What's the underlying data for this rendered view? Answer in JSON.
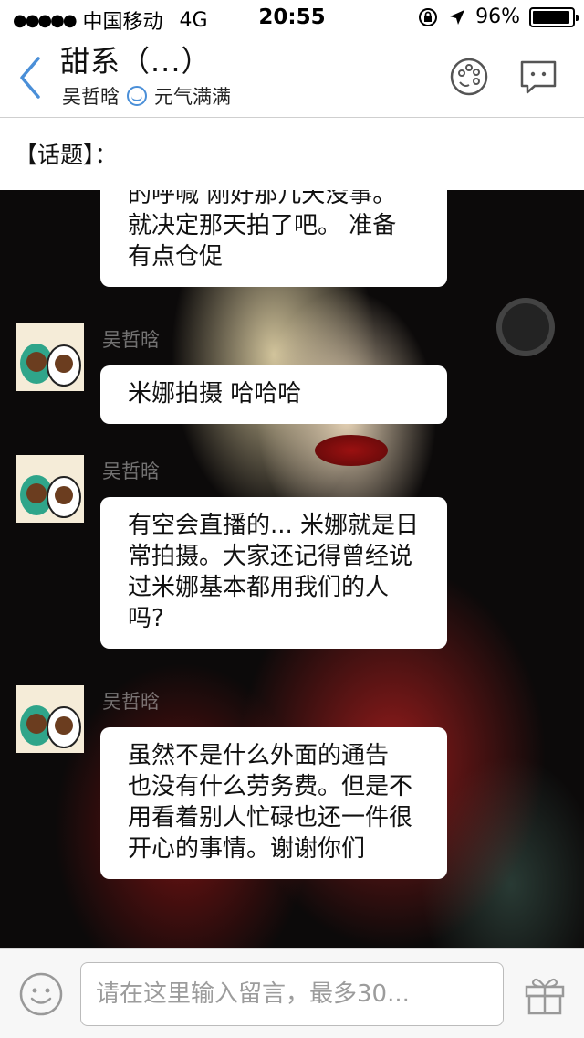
{
  "status_bar": {
    "signal_dots": "●●●●●",
    "carrier": "中国移动",
    "network": "4G",
    "time": "20:55",
    "battery_text": "96%",
    "battery_level": 0.96
  },
  "header": {
    "title": "甜系（...）",
    "author": "吴哲晗",
    "mood": "元气满满"
  },
  "topic": {
    "label": "【话题】："
  },
  "messages": [
    {
      "text": "的呼喊 刚好那几天没事。就决定那天拍了吧。 准备有点仓促"
    },
    {
      "sender": "吴哲晗",
      "text": "米娜拍摄 哈哈哈"
    },
    {
      "sender": "吴哲晗",
      "text": "有空会直播的... 米娜就是日常拍摄。大家还记得曾经说过米娜基本都用我们的人吗?"
    },
    {
      "sender": "吴哲晗",
      "text": "虽然不是什么外面的通告 也没有什么劳务费。但是不用看着别人忙碌也还一件很开心的事情。谢谢你们"
    }
  ],
  "input": {
    "placeholder": "请在这里输入留言，最多30..."
  },
  "colors": {
    "accent": "#4a8fd8",
    "chat_background": "#0c0a0a",
    "bubble": "#ffffff"
  },
  "icons": [
    "back-chevron-icon",
    "palette-icon",
    "chat-bubble-icon",
    "smiley-icon",
    "emoji-icon",
    "gift-icon",
    "location-arrow-icon",
    "rotation-lock-icon"
  ]
}
